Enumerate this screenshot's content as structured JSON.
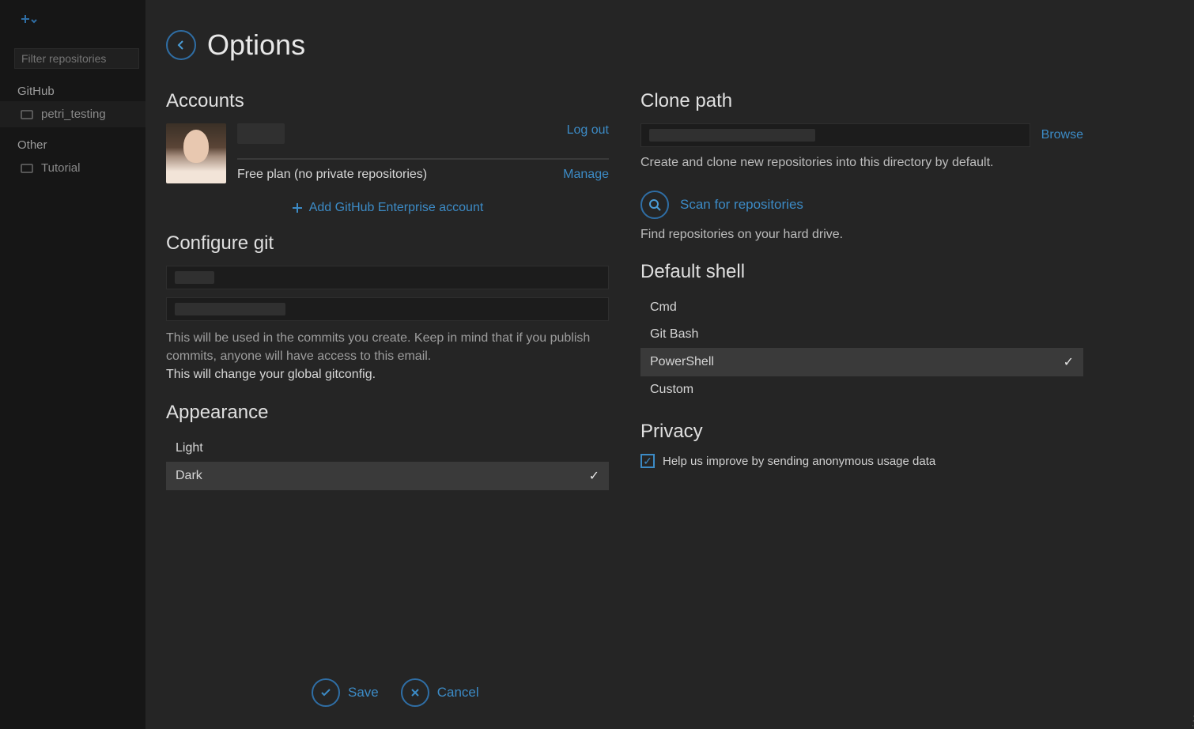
{
  "window": {
    "minimize_icon": "–",
    "maximize_icon": "□",
    "close_icon": "✕"
  },
  "sidebar": {
    "filter_placeholder": "Filter repositories",
    "groups": [
      {
        "label": "GitHub",
        "items": [
          {
            "label": "petri_testing",
            "active": true
          }
        ]
      },
      {
        "label": "Other",
        "items": [
          {
            "label": "Tutorial",
            "active": false
          }
        ]
      }
    ]
  },
  "header": {
    "title": "Options"
  },
  "accounts": {
    "heading": "Accounts",
    "logout_label": "Log out",
    "plan_text": "Free plan (no private repositories)",
    "manage_label": "Manage",
    "add_enterprise_label": "Add GitHub Enterprise account"
  },
  "git": {
    "heading": "Configure git",
    "help1": "This will be used in the commits you create. Keep in mind that if you publish commits, anyone will have access to this email.",
    "help2": "This will change your global gitconfig."
  },
  "appearance": {
    "heading": "Appearance",
    "options": [
      {
        "label": "Light",
        "selected": false
      },
      {
        "label": "Dark",
        "selected": true
      }
    ]
  },
  "clone": {
    "heading": "Clone path",
    "browse_label": "Browse",
    "caption": "Create and clone new repositories into this directory by default.",
    "scan_label": "Scan for repositories",
    "scan_caption": "Find repositories on your hard drive."
  },
  "shell": {
    "heading": "Default shell",
    "options": [
      {
        "label": "Cmd",
        "selected": false
      },
      {
        "label": "Git Bash",
        "selected": false
      },
      {
        "label": "PowerShell",
        "selected": true
      },
      {
        "label": "Custom",
        "selected": false
      }
    ]
  },
  "privacy": {
    "heading": "Privacy",
    "checkbox_label": "Help us improve by sending anonymous usage data",
    "checked": true
  },
  "footer": {
    "save_label": "Save",
    "cancel_label": "Cancel"
  }
}
